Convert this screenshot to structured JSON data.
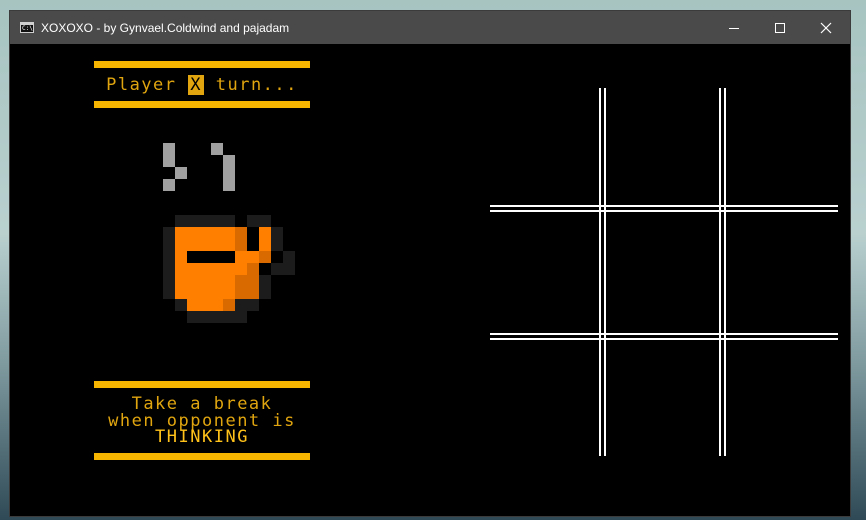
{
  "window": {
    "title": "XOXOXO - by Gynvael.Coldwind and pajadam",
    "icon": "cmd-console-icon",
    "icon_text": "C:\\"
  },
  "game": {
    "turn_prefix": "Player ",
    "current_player": "X",
    "turn_suffix": " turn...",
    "message_line1": "Take a break",
    "message_line2": "when opponent is",
    "message_line3": "THINKING",
    "board_cells": [
      "",
      "",
      "",
      "",
      "",
      "",
      "",
      "",
      ""
    ]
  },
  "colors": {
    "accent": "#f7b500",
    "text": "#e0a50f",
    "mug_orange": "#ff8000",
    "mug_dark_orange": "#d96a00",
    "steam": "#a0a0a0",
    "mug_outline": "#1c1c1c",
    "board_lines": "#ffffff"
  }
}
